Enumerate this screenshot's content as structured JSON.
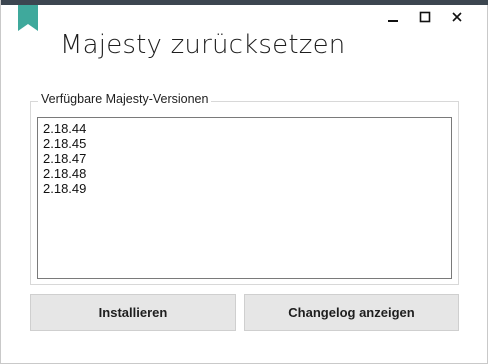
{
  "window": {
    "title": "Majesty zurücksetzen",
    "accent_color": "#3fa99c",
    "controls": [
      {
        "name": "minimize-icon",
        "glyph": "_"
      },
      {
        "name": "maximize-icon",
        "glyph": "□"
      },
      {
        "name": "close-icon",
        "glyph": "✕"
      }
    ]
  },
  "group": {
    "label": "Verfügbare Majesty-Versionen",
    "versions": [
      "2.18.44",
      "2.18.45",
      "2.18.47",
      "2.18.48",
      "2.18.49"
    ]
  },
  "buttons": {
    "install_label": "Installieren",
    "changelog_label": "Changelog anzeigen"
  }
}
